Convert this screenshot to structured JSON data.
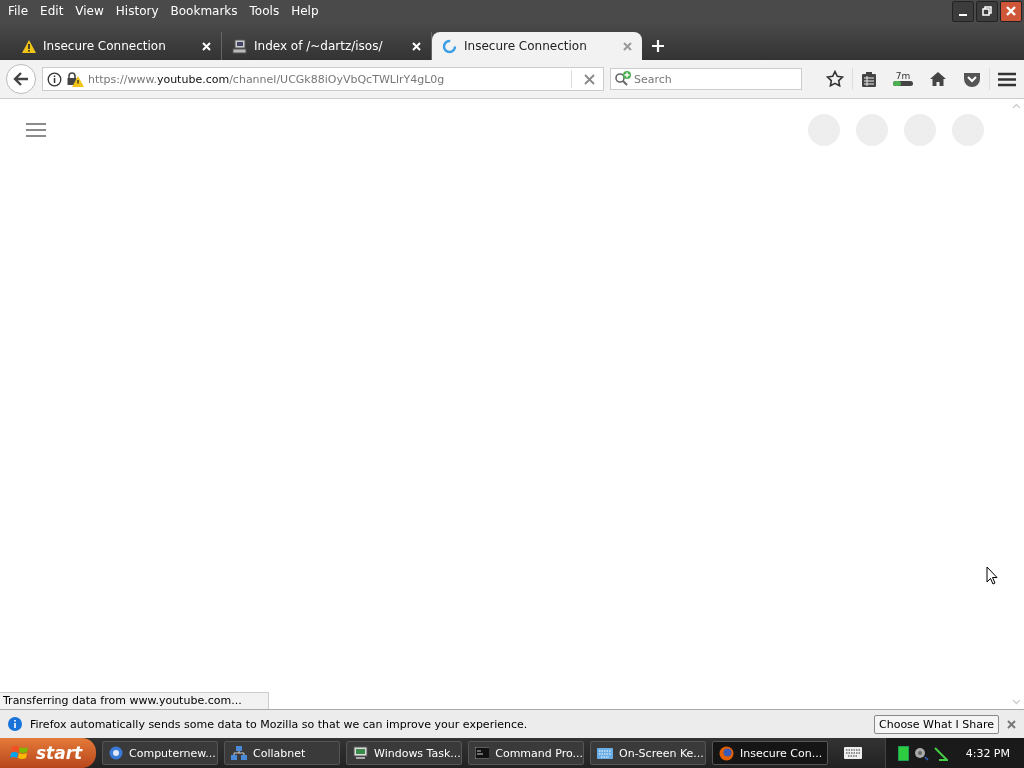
{
  "menu": [
    "File",
    "Edit",
    "View",
    "History",
    "Bookmarks",
    "Tools",
    "Help"
  ],
  "tabs": [
    {
      "title": "Insecure Connection",
      "selected": false
    },
    {
      "title": "Index of /~dartz/isos/",
      "selected": false
    },
    {
      "title": "Insecure Connection",
      "selected": true
    }
  ],
  "url": {
    "prefix": "https://www.",
    "domain": "youtube.com",
    "path": "/channel/UCGk88iOyVbQcTWLlrY4gL0g"
  },
  "search": {
    "placeholder": "Search"
  },
  "timer_badge": "7m",
  "status": "Transferring data from www.youtube.com...",
  "notification": {
    "message": "Firefox automatically sends some data to Mozilla so that we can improve your experience.",
    "button": "Choose What I Share"
  },
  "taskbar": {
    "start": "start",
    "items": [
      {
        "label": "Computernew...",
        "selected": false
      },
      {
        "label": "Collabnet",
        "selected": false
      },
      {
        "label": "Windows Task...",
        "selected": false
      },
      {
        "label": "Command Pro...",
        "selected": false
      },
      {
        "label": "On-Screen Ke...",
        "selected": false
      },
      {
        "label": "Insecure Con...",
        "selected": true
      }
    ],
    "clock": "4:32 PM"
  }
}
